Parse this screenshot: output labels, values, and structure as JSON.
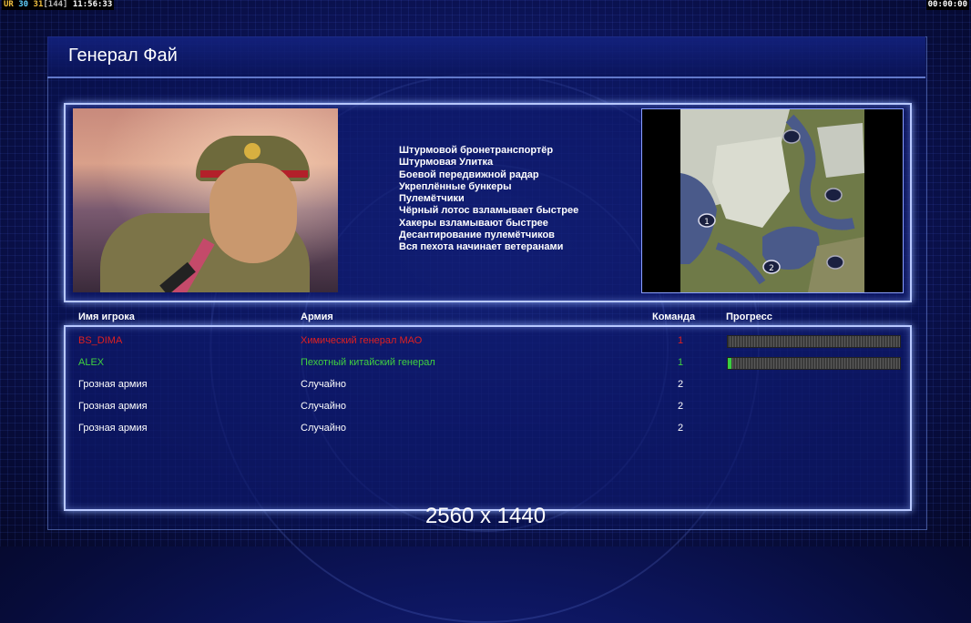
{
  "hud": {
    "left_prefix": "UR",
    "fps_a": "30",
    "fps_b": "31",
    "bracket": "[144]",
    "clock": "11:56:33",
    "timer": "00:00:00"
  },
  "title": "Генерал Фай",
  "perks": [
    "Штурмовой бронетранспортёр",
    "Штурмовая Улитка",
    "Боевой передвижной радар",
    "Укреплённые бункеры",
    "Пулемётчики",
    "Чёрный лотос взламывает быстрее",
    "Хакеры взламывают быстрее",
    "Десантирование пулемётчиков",
    "Вся пехота начинает ветеранами"
  ],
  "map": {
    "markers": [
      "1",
      "2"
    ]
  },
  "table": {
    "headers": {
      "name": "Имя игрока",
      "army": "Армия",
      "team": "Команда",
      "progress": "Прогресс"
    },
    "rows": [
      {
        "name": "BS_DIMA",
        "army": "Химический генерал МАО",
        "team": "1",
        "color": "#e02020",
        "progress": 0.0
      },
      {
        "name": "ALEX",
        "army": "Пехотный китайский генерал",
        "team": "1",
        "color": "#40d040",
        "progress": 0.02
      },
      {
        "name": "Грозная армия",
        "army": "Случайно",
        "team": "2",
        "color": "#ffffff"
      },
      {
        "name": "Грозная армия",
        "army": "Случайно",
        "team": "2",
        "color": "#ffffff"
      },
      {
        "name": "Грозная армия",
        "army": "Случайно",
        "team": "2",
        "color": "#ffffff"
      }
    ]
  },
  "resolution_label": "2560 x 1440"
}
